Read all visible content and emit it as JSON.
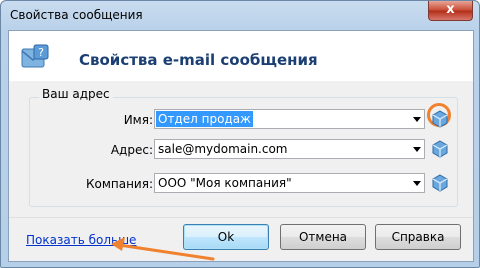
{
  "window": {
    "title": "Свойства сообщения",
    "close_glyph": "x"
  },
  "header": {
    "title": "Свойства e-mail сообщения",
    "icon": "message-properties-icon"
  },
  "group": {
    "legend": "Ваш адрес"
  },
  "fields": {
    "name": {
      "label": "Имя:",
      "value": "Отдел продаж"
    },
    "address": {
      "label": "Адрес:",
      "value": "sale@mydomain.com"
    },
    "company": {
      "label": "Компания:",
      "value": "ООО \"Моя компания\""
    }
  },
  "footer": {
    "more_link": "Показать больше",
    "ok": "Ok",
    "cancel": "Отмена",
    "help": "Справка"
  },
  "colors": {
    "accent": "#1c3f73",
    "highlight": "#f0822f",
    "link": "#0033cc"
  }
}
